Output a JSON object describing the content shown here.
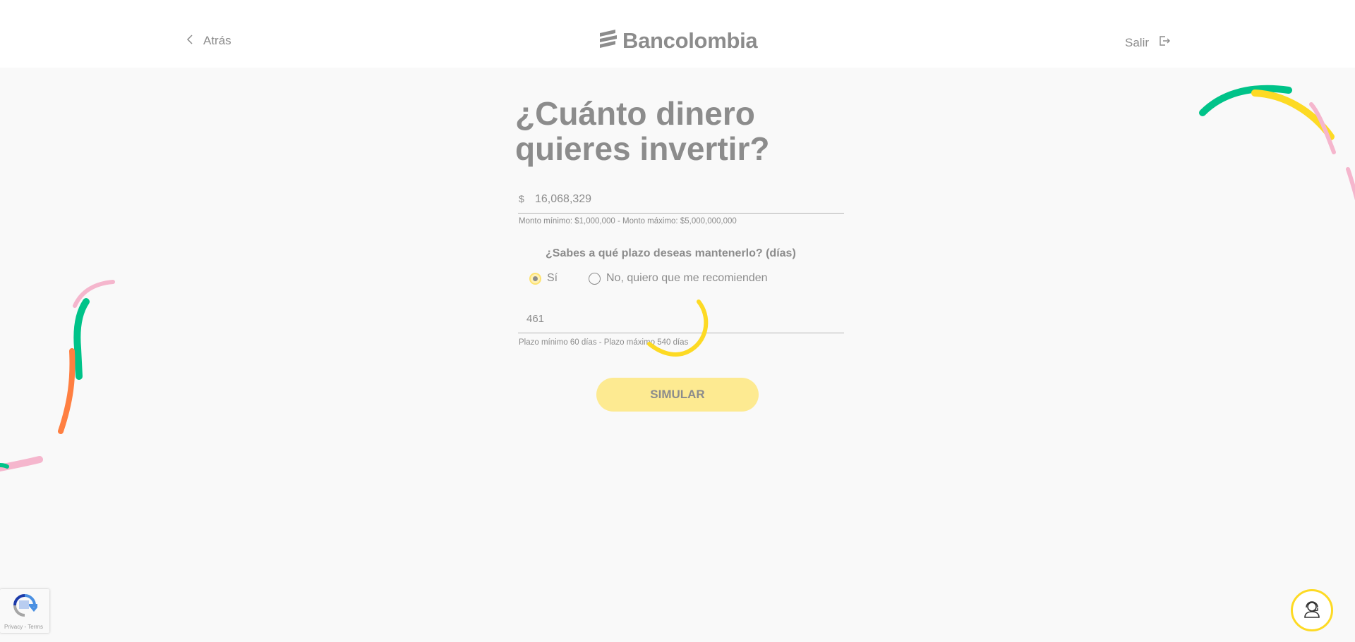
{
  "header": {
    "back_label": "Atrás",
    "brand_name": "Bancolombia",
    "exit_label": "Salir"
  },
  "form": {
    "title": "¿Cuánto dinero quieres invertir?",
    "amount": {
      "currency_symbol": "$",
      "value": "16,068,329",
      "hint": "Monto mínimo: $1,000,000 - Monto máximo: $5,000,000,000"
    },
    "term_question": "¿Sabes a qué plazo deseas mantenerlo? (días)",
    "options": {
      "yes_label": "Sí",
      "no_label": "No, quiero que me recomienden",
      "selected": "yes"
    },
    "days": {
      "value": "461",
      "hint": "Plazo mínimo 60 días - Plazo máximo 540 días"
    },
    "submit_label": "SIMULAR"
  },
  "recaptcha": {
    "terms": "Privacy - Terms"
  },
  "colors": {
    "brand_yellow": "#fdda24",
    "button_yellow": "#fdea91",
    "text_gray": "#8c8c8c",
    "deco_green": "#00c389",
    "deco_pink": "#f5b6cd",
    "deco_orange": "#ff7f41"
  },
  "icons": {
    "back": "chevron-left-icon",
    "brand": "bancolombia-logo-icon",
    "exit": "logout-icon",
    "help": "support-agent-icon",
    "recaptcha": "recaptcha-icon",
    "loading": "loading-spinner-icon"
  }
}
